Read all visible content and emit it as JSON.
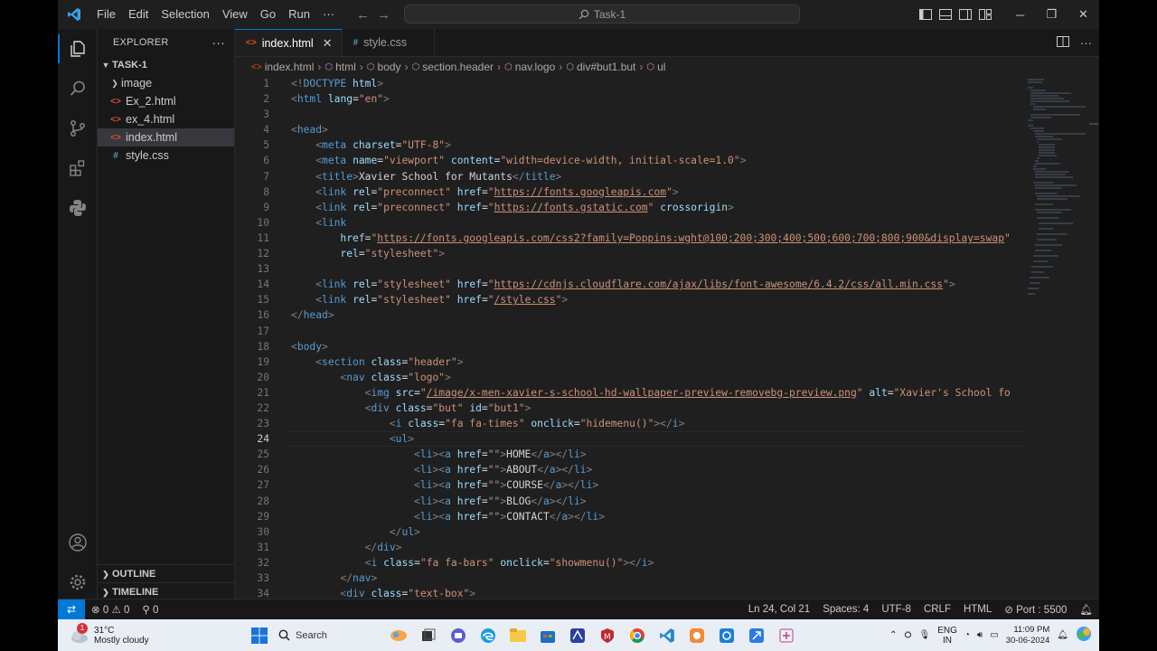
{
  "menu": {
    "items": [
      "File",
      "Edit",
      "Selection",
      "View",
      "Go",
      "Run",
      "···"
    ]
  },
  "command_center": {
    "label": "Task-1"
  },
  "sidebar": {
    "title": "EXPLORER",
    "more": "···",
    "folder": "TASK-1",
    "items": [
      {
        "label": "image",
        "type": "folder"
      },
      {
        "label": "Ex_2.html",
        "type": "html"
      },
      {
        "label": "ex_4.html",
        "type": "html"
      },
      {
        "label": "index.html",
        "type": "html"
      },
      {
        "label": "style.css",
        "type": "css"
      }
    ],
    "outline": "OUTLINE",
    "timeline": "TIMELINE"
  },
  "tabs": [
    {
      "label": "index.html",
      "icon": "<>",
      "active": true
    },
    {
      "label": "style.css",
      "icon": "#",
      "active": false
    }
  ],
  "breadcrumb": [
    "index.html",
    "html",
    "body",
    "section.header",
    "nav.logo",
    "div#but1.but",
    "ul"
  ],
  "code": {
    "current_line": 24,
    "line_numbers": [
      "1",
      "2",
      "3",
      "4",
      "5",
      "6",
      "7",
      "8",
      "9",
      "10",
      "11",
      "12",
      "13",
      "14",
      "15",
      "16",
      "17",
      "18",
      "19",
      "20",
      "21",
      "22",
      "23",
      "24",
      "25",
      "26",
      "27",
      "28",
      "29",
      "30",
      "31",
      "32",
      "33",
      "34"
    ]
  },
  "statusbar": {
    "errors": "0",
    "warnings": "0",
    "ports_count": "0",
    "cursor": "Ln 24, Col 21",
    "spaces": "Spaces: 4",
    "encoding": "UTF-8",
    "eol": "CRLF",
    "language": "HTML",
    "port": "Port : 5500"
  },
  "taskbar": {
    "weather_badge": "1",
    "temperature": "31°C",
    "weather": "Mostly cloudy",
    "search": "Search",
    "lang": "ENG",
    "region": "IN",
    "time": "11:09 PM",
    "date": "30-06-2024"
  },
  "colors": {
    "accent": "#0078d4",
    "tag": "#569cd6",
    "attr": "#9cdcfe",
    "string": "#ce9178"
  }
}
